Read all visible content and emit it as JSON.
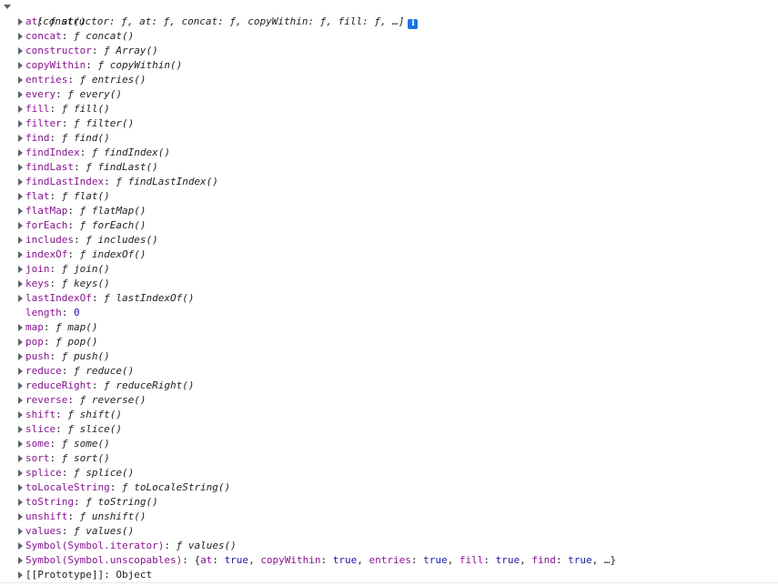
{
  "header": {
    "preview": "[constructor: ƒ, at: ƒ, concat: ƒ, copyWithin: ƒ, fill: ƒ, …]",
    "info_icon": "i"
  },
  "entries": [
    {
      "key": "at",
      "value": "ƒ at()",
      "kind": "fn"
    },
    {
      "key": "concat",
      "value": "ƒ concat()",
      "kind": "fn"
    },
    {
      "key": "constructor",
      "value": "ƒ Array()",
      "kind": "fn"
    },
    {
      "key": "copyWithin",
      "value": "ƒ copyWithin()",
      "kind": "fn"
    },
    {
      "key": "entries",
      "value": "ƒ entries()",
      "kind": "fn"
    },
    {
      "key": "every",
      "value": "ƒ every()",
      "kind": "fn"
    },
    {
      "key": "fill",
      "value": "ƒ fill()",
      "kind": "fn"
    },
    {
      "key": "filter",
      "value": "ƒ filter()",
      "kind": "fn"
    },
    {
      "key": "find",
      "value": "ƒ find()",
      "kind": "fn"
    },
    {
      "key": "findIndex",
      "value": "ƒ findIndex()",
      "kind": "fn"
    },
    {
      "key": "findLast",
      "value": "ƒ findLast()",
      "kind": "fn"
    },
    {
      "key": "findLastIndex",
      "value": "ƒ findLastIndex()",
      "kind": "fn"
    },
    {
      "key": "flat",
      "value": "ƒ flat()",
      "kind": "fn"
    },
    {
      "key": "flatMap",
      "value": "ƒ flatMap()",
      "kind": "fn"
    },
    {
      "key": "forEach",
      "value": "ƒ forEach()",
      "kind": "fn"
    },
    {
      "key": "includes",
      "value": "ƒ includes()",
      "kind": "fn"
    },
    {
      "key": "indexOf",
      "value": "ƒ indexOf()",
      "kind": "fn"
    },
    {
      "key": "join",
      "value": "ƒ join()",
      "kind": "fn"
    },
    {
      "key": "keys",
      "value": "ƒ keys()",
      "kind": "fn"
    },
    {
      "key": "lastIndexOf",
      "value": "ƒ lastIndexOf()",
      "kind": "fn"
    },
    {
      "key": "length",
      "value": "0",
      "kind": "num"
    },
    {
      "key": "map",
      "value": "ƒ map()",
      "kind": "fn"
    },
    {
      "key": "pop",
      "value": "ƒ pop()",
      "kind": "fn"
    },
    {
      "key": "push",
      "value": "ƒ push()",
      "kind": "fn"
    },
    {
      "key": "reduce",
      "value": "ƒ reduce()",
      "kind": "fn"
    },
    {
      "key": "reduceRight",
      "value": "ƒ reduceRight()",
      "kind": "fn"
    },
    {
      "key": "reverse",
      "value": "ƒ reverse()",
      "kind": "fn"
    },
    {
      "key": "shift",
      "value": "ƒ shift()",
      "kind": "fn"
    },
    {
      "key": "slice",
      "value": "ƒ slice()",
      "kind": "fn"
    },
    {
      "key": "some",
      "value": "ƒ some()",
      "kind": "fn"
    },
    {
      "key": "sort",
      "value": "ƒ sort()",
      "kind": "fn"
    },
    {
      "key": "splice",
      "value": "ƒ splice()",
      "kind": "fn"
    },
    {
      "key": "toLocaleString",
      "value": "ƒ toLocaleString()",
      "kind": "fn"
    },
    {
      "key": "toString",
      "value": "ƒ toString()",
      "kind": "fn"
    },
    {
      "key": "unshift",
      "value": "ƒ unshift()",
      "kind": "fn"
    },
    {
      "key": "values",
      "value": "ƒ values()",
      "kind": "fn"
    },
    {
      "key": "Symbol(Symbol.iterator)",
      "value": "ƒ values()",
      "kind": "fn"
    },
    {
      "key": "Symbol(Symbol.unscopables)",
      "value": "",
      "kind": "obj",
      "parts": [
        {
          "t": "{",
          "c": "plain"
        },
        {
          "t": "at",
          "c": "key"
        },
        {
          "t": ": ",
          "c": "plain"
        },
        {
          "t": "true",
          "c": "bool"
        },
        {
          "t": ", ",
          "c": "plain"
        },
        {
          "t": "copyWithin",
          "c": "key"
        },
        {
          "t": ": ",
          "c": "plain"
        },
        {
          "t": "true",
          "c": "bool"
        },
        {
          "t": ", ",
          "c": "plain"
        },
        {
          "t": "entries",
          "c": "key"
        },
        {
          "t": ": ",
          "c": "plain"
        },
        {
          "t": "true",
          "c": "bool"
        },
        {
          "t": ", ",
          "c": "plain"
        },
        {
          "t": "fill",
          "c": "key"
        },
        {
          "t": ": ",
          "c": "plain"
        },
        {
          "t": "true",
          "c": "bool"
        },
        {
          "t": ", ",
          "c": "plain"
        },
        {
          "t": "find",
          "c": "key"
        },
        {
          "t": ": ",
          "c": "plain"
        },
        {
          "t": "true",
          "c": "bool"
        },
        {
          "t": ", …}",
          "c": "plain"
        }
      ]
    },
    {
      "key": "[[Prototype]]",
      "value": "Object",
      "kind": "proto"
    }
  ],
  "colors": {
    "key": "#881391",
    "number": "#1a1aa6",
    "text": "#1f1f1f",
    "info_icon_bg": "#1a73e8"
  }
}
